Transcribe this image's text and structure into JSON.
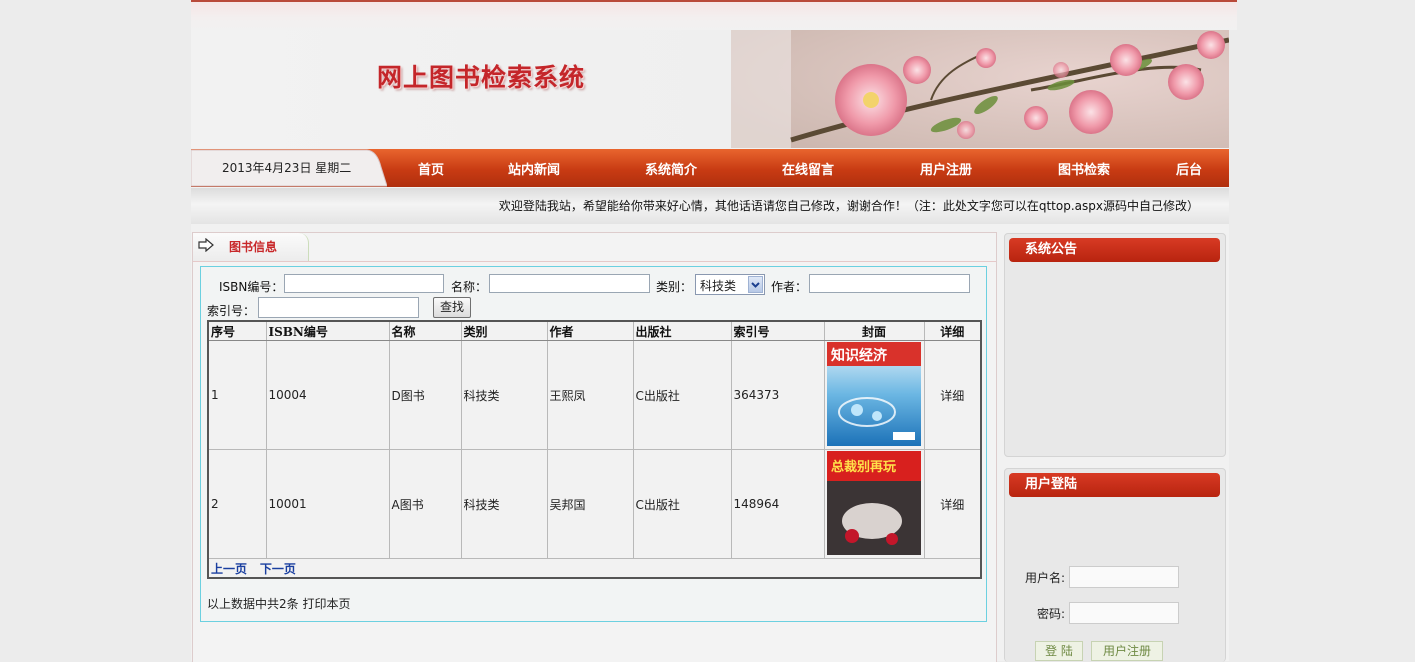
{
  "header": {
    "site_title": "网上图书检索系统",
    "date": "2013年4月23日 星期二"
  },
  "nav": {
    "items": [
      "首页",
      "站内新闻",
      "系统简介",
      "在线留言",
      "用户注册",
      "图书检索",
      "后台"
    ]
  },
  "ticker": {
    "text": "欢迎登陆我站，希望能给你带来好心情，其他话语请您自己修改，谢谢合作！（注：此处文字您可以在qttop.aspx源码中自己修改）"
  },
  "main": {
    "title": "图书信息",
    "search": {
      "isbn_label": "ISBN编号：",
      "name_label": "名称：",
      "category_label": "类别：",
      "category_value": "科技类",
      "author_label": "作者：",
      "index_label": "索引号：",
      "search_button": "查找"
    },
    "table": {
      "headers": [
        "序号",
        "ISBN编号",
        "名称",
        "类别",
        "作者",
        "出版社",
        "索引号",
        "封面",
        "详细"
      ],
      "rows": [
        {
          "no": "1",
          "isbn": "10004",
          "name": "D图书",
          "category": "科技类",
          "author": "王熙凤",
          "publisher": "C出版社",
          "index": "364373",
          "detail": "详细"
        },
        {
          "no": "2",
          "isbn": "10001",
          "name": "A图书",
          "category": "科技类",
          "author": "吴邦国",
          "publisher": "C出版社",
          "index": "148964",
          "detail": "详细"
        }
      ],
      "pager": {
        "prev": "上一页",
        "next": "下一页"
      }
    },
    "summary": "以上数据中共2条  打印本页"
  },
  "sidebar": {
    "notice_title": "系统公告",
    "login": {
      "title": "用户登陆",
      "username_label": "用户名:",
      "password_label": "密码:",
      "login_button": "登 陆",
      "register_button": "用户注册"
    }
  },
  "colors": {
    "accent": "#c8282a",
    "nav": "#c83b13",
    "border_cyan": "#6cd0e0"
  }
}
